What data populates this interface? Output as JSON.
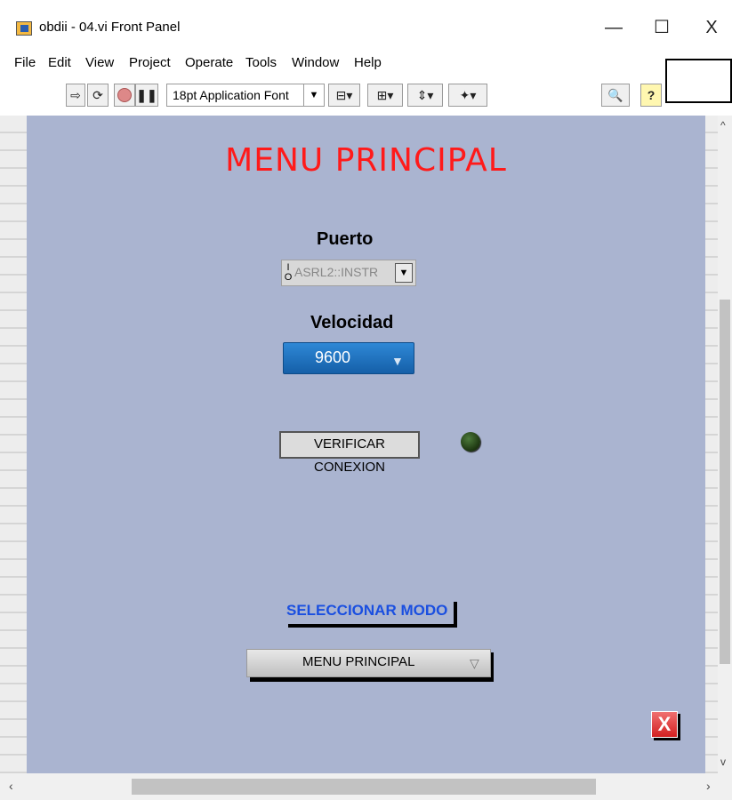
{
  "window": {
    "title": "obdii - 04.vi Front Panel",
    "minimize": "—",
    "maximize": "☐",
    "close": "X"
  },
  "menubar": [
    "File",
    "Edit",
    "View",
    "Project",
    "Operate",
    "Tools",
    "Window",
    "Help"
  ],
  "toolbar": {
    "font": "18pt Application Font"
  },
  "panel": {
    "background_color": "#aab4d0",
    "title": "MENU PRINCIPAL",
    "puerto": {
      "label": "Puerto",
      "value": "ASRL2::INSTR"
    },
    "velocidad": {
      "label": "Velocidad",
      "value": "9600"
    },
    "verificar_button": "VERIFICAR CONEXION",
    "led_state": "off",
    "seleccionar_label": "SELECCIONAR MODO",
    "mode_select": {
      "value": "MENU PRINCIPAL"
    },
    "stop_button": "X"
  },
  "icons": [
    "run-arrow-icon",
    "run-continuous-icon",
    "abort-icon",
    "pause-icon",
    "align-icon",
    "distribute-icon",
    "resize-icon",
    "reorder-icon",
    "search-icon",
    "help-icon"
  ]
}
